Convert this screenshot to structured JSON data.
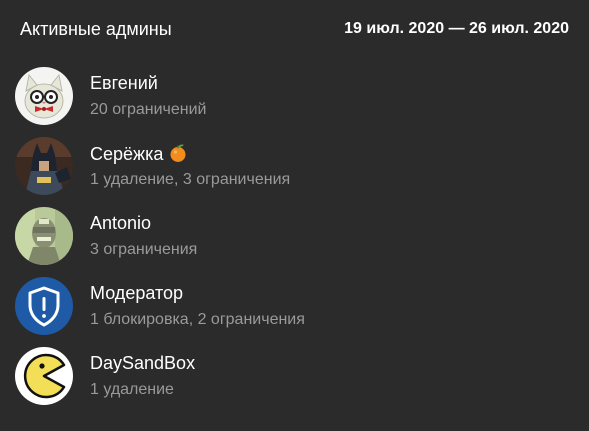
{
  "header": {
    "title": "Активные админы",
    "date_range": "19 июл. 2020 — 26 июл. 2020"
  },
  "admins": [
    {
      "name": "Евгений",
      "stats": "20 ограничений",
      "avatar_icon": "cat-with-glasses-avatar"
    },
    {
      "name": "Серёжка",
      "stats": "1 удаление, 3 ограничения",
      "avatar_icon": "batman-avatar",
      "badge_icon": "tangerine-emoji"
    },
    {
      "name": "Antonio",
      "stats": "3 ограничения",
      "avatar_icon": "person-photo-avatar"
    },
    {
      "name": "Модератор",
      "stats": "1 блокировка, 2 ограничения",
      "avatar_icon": "shield-exclamation-avatar"
    },
    {
      "name": "DaySandBox",
      "stats": "1 удаление",
      "avatar_icon": "pacman-avatar"
    }
  ],
  "colors": {
    "background": "#2b2b2b",
    "primary_text": "#ffffff",
    "secondary_text": "#9a9a9a",
    "shield_blue": "#1f5aa6"
  }
}
